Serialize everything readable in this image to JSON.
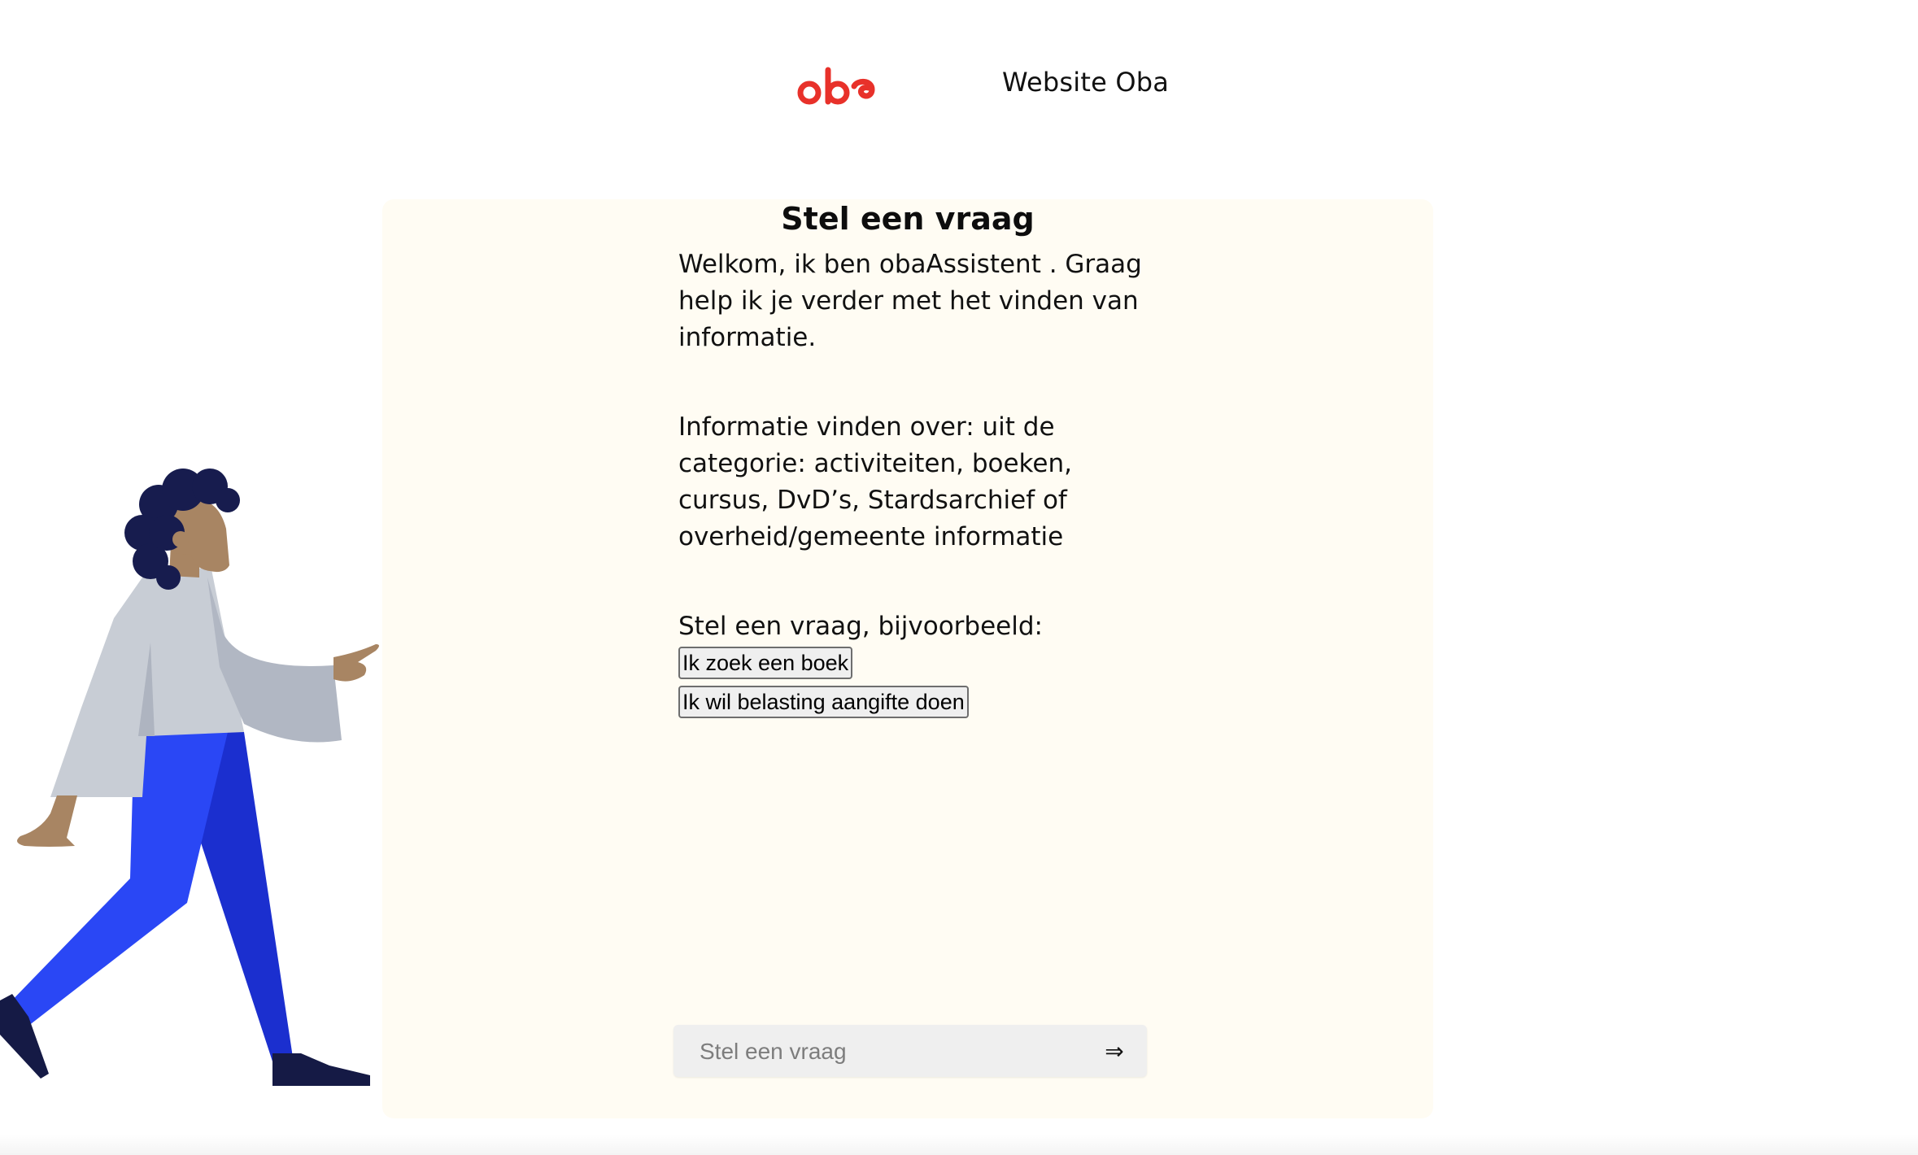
{
  "header": {
    "logo_text": "oba",
    "website_link": "Website Oba"
  },
  "chat": {
    "title": "Stel een vraag",
    "messages": [
      "Welkom, ik ben obaAssistent . Graag help ik je verder met het vinden van informatie.",
      "Informatie vinden over: uit de categorie: activiteiten, boeken, cursus, DvD’s, Stardsarchief of overheid/gemeente informatie",
      "Stel een vraag, bijvoorbeeld:"
    ],
    "suggestions": [
      "Ik zoek een boek",
      "Ik wil belasting aangifte doen"
    ],
    "input": {
      "placeholder": "Stel een vraag",
      "value": ""
    },
    "send_symbol": "⇒"
  },
  "colors": {
    "brand_red": "#e8312a",
    "card_background": "#fffcf3",
    "input_background": "#efefef"
  },
  "icons": {
    "send": "double-arrow-right-icon",
    "logo": "oba-logo"
  }
}
